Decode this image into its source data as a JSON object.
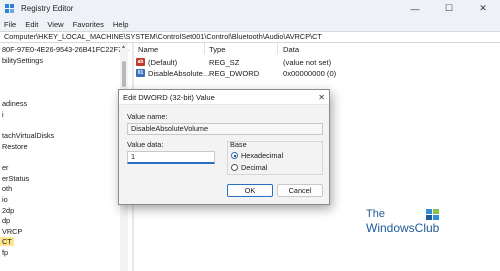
{
  "window": {
    "title": "Registry Editor",
    "controls": [
      "minimize-icon",
      "maximize-icon",
      "close-icon"
    ],
    "minimize_glyph": "—",
    "maximize_glyph": "☐",
    "close_glyph": "✕"
  },
  "menu": [
    "File",
    "Edit",
    "View",
    "Favorites",
    "Help"
  ],
  "address": "Computer\\HKEY_LOCAL_MACHINE\\SYSTEM\\ControlSet001\\Control\\Bluetooth\\Audio\\AVRCP\\CT",
  "tree": {
    "items": [
      {
        "label": "80F-97E0-4E26-9543-26B41FC22F79}"
      },
      {
        "label": "bilitySettings"
      },
      {
        "label": ""
      },
      {
        "label": "adiness"
      },
      {
        "label": "i"
      },
      {
        "label": ""
      },
      {
        "label": "tachVirtualDisks"
      },
      {
        "label": "Restore"
      },
      {
        "label": ""
      },
      {
        "label": "er"
      },
      {
        "label": "erStatus"
      },
      {
        "label": "oth"
      },
      {
        "label": "io"
      },
      {
        "label": "2dp"
      },
      {
        "label": "dp"
      },
      {
        "label": "VRCP"
      },
      {
        "label": "CT"
      },
      {
        "label": "fp"
      }
    ],
    "selected": "CT"
  },
  "values": {
    "columns": {
      "name": "Name",
      "type": "Type",
      "data": "Data"
    },
    "rows": [
      {
        "icon": "string-value-icon",
        "icon_text": "ab",
        "name": "(Default)",
        "type": "REG_SZ",
        "data": "(value not set)"
      },
      {
        "icon": "dword-value-icon",
        "icon_text": "01",
        "name": "DisableAbsolute...",
        "type": "REG_DWORD",
        "data": "0x00000000 (0)"
      }
    ]
  },
  "dialog": {
    "title": "Edit DWORD (32-bit) Value",
    "close_glyph": "✕",
    "value_name_label": "Value name:",
    "value_name": "DisableAbsoluteVolume",
    "value_data_label": "Value data:",
    "value_data": "1",
    "base_label": "Base",
    "base_options": [
      {
        "label": "Hexadecimal",
        "selected": true
      },
      {
        "label": "Decimal",
        "selected": false
      }
    ],
    "ok_label": "OK",
    "cancel_label": "Cancel"
  },
  "watermark": {
    "line1": "The",
    "line2": "WindowsClub",
    "colors": [
      "#1f5a97",
      "#2f8fd8",
      "#8bc34a"
    ]
  }
}
